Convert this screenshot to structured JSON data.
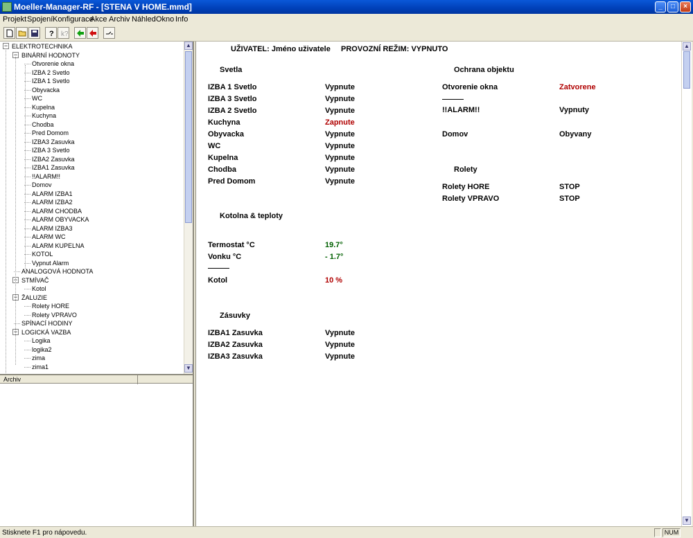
{
  "window": {
    "title": "Moeller-Manager-RF - [STENA V HOME.mmd]"
  },
  "menu": [
    "Projekt",
    "Spojení",
    "Konfigurace",
    "Akce",
    "Archiv",
    "Náhled",
    "Okno",
    "Info"
  ],
  "toolbar": {
    "icons": [
      "new-file-icon",
      "open-folder-icon",
      "save-icon",
      "help-icon",
      "context-help-icon",
      "connect-icon",
      "disconnect-icon",
      "line-icon"
    ]
  },
  "tree": {
    "root": "ELEKTROTECHNIKA",
    "binary_label": "BINÁRNÍ HODNOTY",
    "binary_items": [
      "Otvorenie okna",
      "IZBA 2 Svetlo",
      "IZBA 1 Svetlo",
      "Obyvacka",
      "WC",
      "Kupelna",
      "Kuchyna",
      "Chodba",
      "Pred Domom",
      "IZBA3 Zasuvka",
      "IZBA 3 Svetlo",
      "IZBA2 Zasuvka",
      "IZBA1 Zasuvka",
      "!!ALARM!!",
      "Domov",
      "ALARM IZBA1",
      "ALARM IZBA2",
      "ALARM CHODBA",
      "ALARM OBYVACKA",
      "ALARM IZBA3",
      "ALARM WC",
      "ALARM KUPELNA",
      "KOTOL",
      "Vypnut Alarm"
    ],
    "analog_label": "ANALOGOVÁ HODNOTA",
    "dimmer_label": "STMÍVAČ",
    "dimmer_items": [
      "Kotol"
    ],
    "blinds_label": "ŽALUZIE",
    "blinds_items": [
      "Rolety HORE",
      "Rolety VPRAVO"
    ],
    "timer_label": "SPÍNACÍ HODINY",
    "logic_label": "LOGICKÁ VAZBA",
    "logic_items": [
      "Logika",
      "logika2",
      "zima",
      "zima1"
    ]
  },
  "archiv": {
    "column": "Archiv"
  },
  "main": {
    "user_line": "UŽIVATEL: Jméno uživatele",
    "mode_line": "PROVOZNÍ REŽIM: VYPNUTO",
    "lights": {
      "title": "Svetla",
      "rows": [
        {
          "name": "IZBA 1 Svetlo",
          "value": "Vypnute",
          "color": "#000000"
        },
        {
          "name": "IZBA 3 Svetlo",
          "value": "Vypnute",
          "color": "#000000"
        },
        {
          "name": "IZBA 2 Svetlo",
          "value": "Vypnute",
          "color": "#000000"
        },
        {
          "name": "Kuchyna",
          "value": "Zapnute",
          "color": "#b00000"
        },
        {
          "name": "Obyvacka",
          "value": "Vypnute",
          "color": "#000000"
        },
        {
          "name": "WC",
          "value": "Vypnute",
          "color": "#000000"
        },
        {
          "name": "Kupelna",
          "value": "Vypnute",
          "color": "#000000"
        },
        {
          "name": "Chodba",
          "value": "Vypnute",
          "color": "#000000"
        },
        {
          "name": "Pred Domom",
          "value": "Vypnute",
          "color": "#000000"
        }
      ]
    },
    "protection": {
      "title": "Ochrana objektu",
      "window_name": "Otvorenie okna",
      "window_value": "Zatvorene",
      "divider": "———",
      "alarm_name": "!!ALARM!!",
      "alarm_value": "Vypnuty",
      "home_name": "Domov",
      "home_value": "Obyvany"
    },
    "blinds": {
      "title": "Rolety",
      "up_name": "Rolety HORE",
      "up_value": "STOP",
      "right_name": "Rolety VPRAVO",
      "right_value": "STOP"
    },
    "boiler": {
      "title": "Kotolna & teploty",
      "thermostat_name": "Termostat °C",
      "thermostat_value": "19.7°",
      "outside_name": "Vonku °C",
      "outside_value": "- 1.7°",
      "divider": "———",
      "boiler_name": "Kotol",
      "boiler_value": "10 %"
    },
    "sockets": {
      "title": "Zásuvky",
      "rows": [
        {
          "name": "IZBA1 Zasuvka",
          "value": "Vypnute"
        },
        {
          "name": "IZBA2 Zasuvka",
          "value": "Vypnute"
        },
        {
          "name": "IZBA3 Zasuvka",
          "value": "Vypnute"
        }
      ]
    }
  },
  "status": {
    "text": "Stisknete F1 pro nápovedu.",
    "num": "NUM"
  },
  "colors": {
    "on": "#b00000",
    "temp": "#006000",
    "titlebar": "#0a58d8"
  }
}
